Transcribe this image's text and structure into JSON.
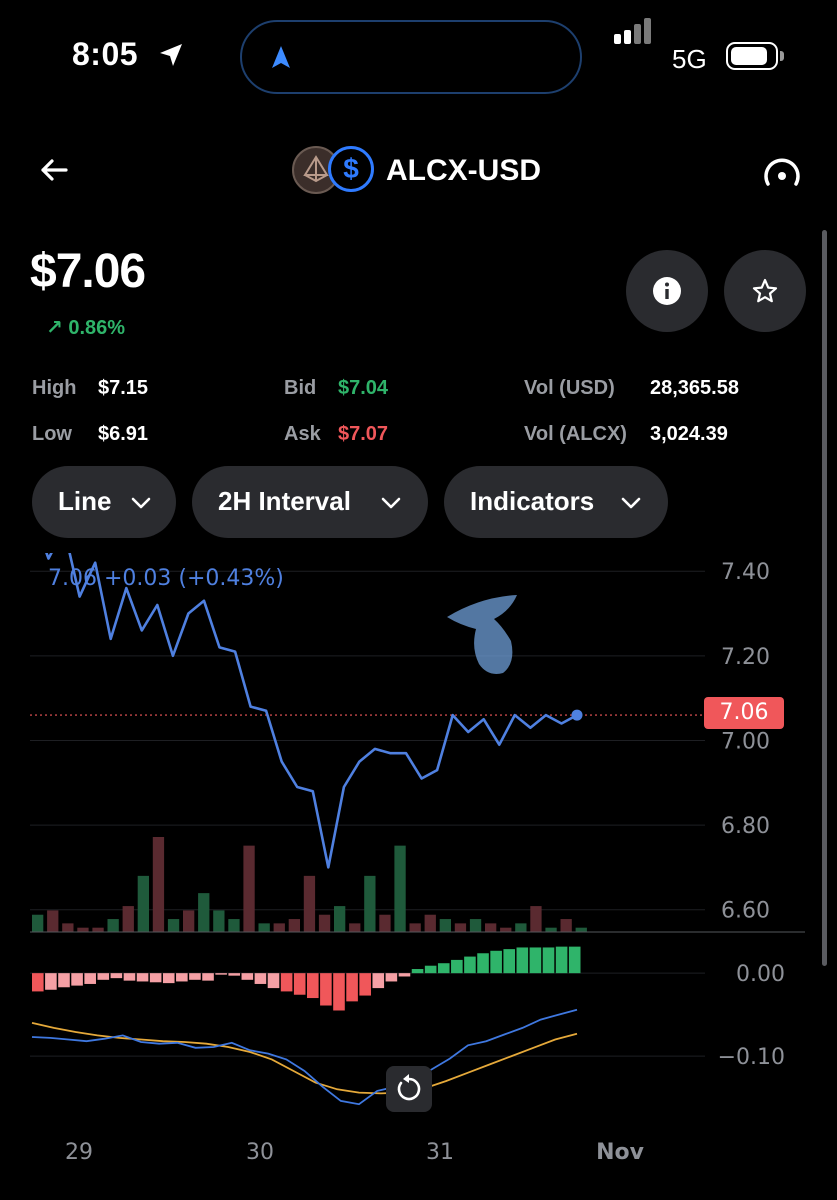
{
  "status_bar": {
    "time": "8:05",
    "network": "5G",
    "icons": [
      "location-arrow-icon",
      "signal-icon",
      "battery-icon"
    ]
  },
  "header": {
    "title": "ALCX-USD",
    "icons": [
      "back-arrow-icon",
      "alcx-coin-icon",
      "usd-coin-icon",
      "gauge-icon"
    ],
    "usd_symbol": "$"
  },
  "quote": {
    "price": "$7.06",
    "change": "0.86%",
    "stats": {
      "high_label": "High",
      "high": "$7.15",
      "low_label": "Low",
      "low": "$6.91",
      "bid_label": "Bid",
      "bid": "$7.04",
      "ask_label": "Ask",
      "ask": "$7.07",
      "vol_usd_label": "Vol (USD)",
      "vol_usd": "28,365.58",
      "vol_alcx_label": "Vol (ALCX)",
      "vol_alcx": "3,024.39"
    },
    "colors": {
      "up": "#2fb46a",
      "down": "#f0575a",
      "line": "#4f80e0"
    }
  },
  "controls": {
    "chart_type": "Line",
    "interval": "2H Interval",
    "indicators": "Indicators"
  },
  "chart_data": {
    "type": "line",
    "tooltip": "7.06 +0.03 (+0.43%)",
    "current_price_tag": "7.06",
    "y_ticks": [
      "7.40",
      "7.20",
      "7.00",
      "6.80",
      "6.60"
    ],
    "y_ticks_values": [
      7.4,
      7.2,
      7.0,
      6.8,
      6.6
    ],
    "ylim": [
      6.545,
      7.443
    ],
    "x_ticks": [
      "29",
      "30",
      "31",
      "Nov"
    ],
    "price": [
      7.53,
      7.43,
      7.5,
      7.34,
      7.42,
      7.24,
      7.36,
      7.26,
      7.32,
      7.2,
      7.3,
      7.33,
      7.22,
      7.21,
      7.08,
      7.07,
      6.95,
      6.89,
      6.88,
      6.7,
      6.89,
      6.95,
      6.98,
      6.97,
      6.97,
      6.91,
      6.93,
      7.06,
      7.02,
      7.05,
      6.99,
      7.06,
      7.03,
      7.06,
      7.04,
      7.06
    ],
    "volume": [
      {
        "v": 4,
        "up": true
      },
      {
        "v": 5,
        "up": false
      },
      {
        "v": 2,
        "up": false
      },
      {
        "v": 1,
        "up": false
      },
      {
        "v": 1,
        "up": false
      },
      {
        "v": 3,
        "up": true
      },
      {
        "v": 6,
        "up": false
      },
      {
        "v": 13,
        "up": true
      },
      {
        "v": 22,
        "up": false
      },
      {
        "v": 3,
        "up": true
      },
      {
        "v": 5,
        "up": false
      },
      {
        "v": 9,
        "up": true
      },
      {
        "v": 5,
        "up": true
      },
      {
        "v": 3,
        "up": true
      },
      {
        "v": 20,
        "up": false
      },
      {
        "v": 2,
        "up": true
      },
      {
        "v": 2,
        "up": false
      },
      {
        "v": 3,
        "up": false
      },
      {
        "v": 13,
        "up": false
      },
      {
        "v": 4,
        "up": false
      },
      {
        "v": 6,
        "up": true
      },
      {
        "v": 2,
        "up": false
      },
      {
        "v": 13,
        "up": true
      },
      {
        "v": 4,
        "up": false
      },
      {
        "v": 20,
        "up": true
      },
      {
        "v": 2,
        "up": false
      },
      {
        "v": 4,
        "up": false
      },
      {
        "v": 3,
        "up": true
      },
      {
        "v": 2,
        "up": false
      },
      {
        "v": 3,
        "up": true
      },
      {
        "v": 2,
        "up": false
      },
      {
        "v": 1,
        "up": false
      },
      {
        "v": 2,
        "up": true
      },
      {
        "v": 6,
        "up": false
      },
      {
        "v": 1,
        "up": true
      },
      {
        "v": 3,
        "up": false
      },
      {
        "v": 1,
        "up": true
      }
    ],
    "macd_y_ticks": [
      "0.00",
      "−0.10"
    ],
    "macd_y_values": [
      0.0,
      -0.1
    ],
    "macd_ylim": [
      -0.165,
      0.04
    ],
    "macd_hist": [
      -0.022,
      -0.02,
      -0.017,
      -0.015,
      -0.013,
      -0.008,
      -0.006,
      -0.009,
      -0.01,
      -0.011,
      -0.012,
      -0.01,
      -0.008,
      -0.009,
      -0.001,
      -0.003,
      -0.008,
      -0.013,
      -0.018,
      -0.022,
      -0.026,
      -0.03,
      -0.039,
      -0.045,
      -0.034,
      -0.027,
      -0.018,
      -0.01,
      -0.004,
      0.005,
      0.009,
      0.012,
      0.016,
      0.02,
      0.024,
      0.027,
      0.029,
      0.031,
      0.031,
      0.031,
      0.032,
      0.032
    ],
    "macd_line": [
      -0.077,
      -0.078,
      -0.08,
      -0.082,
      -0.079,
      -0.075,
      -0.083,
      -0.085,
      -0.084,
      -0.09,
      -0.089,
      -0.084,
      -0.093,
      -0.097,
      -0.104,
      -0.118,
      -0.137,
      -0.154,
      -0.158,
      -0.142,
      -0.137,
      -0.128,
      -0.116,
      -0.103,
      -0.087,
      -0.082,
      -0.074,
      -0.066,
      -0.056,
      -0.05,
      -0.044
    ],
    "signal_line": [
      -0.06,
      -0.066,
      -0.071,
      -0.075,
      -0.078,
      -0.08,
      -0.082,
      -0.083,
      -0.085,
      -0.089,
      -0.095,
      -0.104,
      -0.118,
      -0.132,
      -0.14,
      -0.144,
      -0.145,
      -0.144,
      -0.139,
      -0.13,
      -0.12,
      -0.11,
      -0.1,
      -0.09,
      -0.08,
      -0.073
    ]
  }
}
